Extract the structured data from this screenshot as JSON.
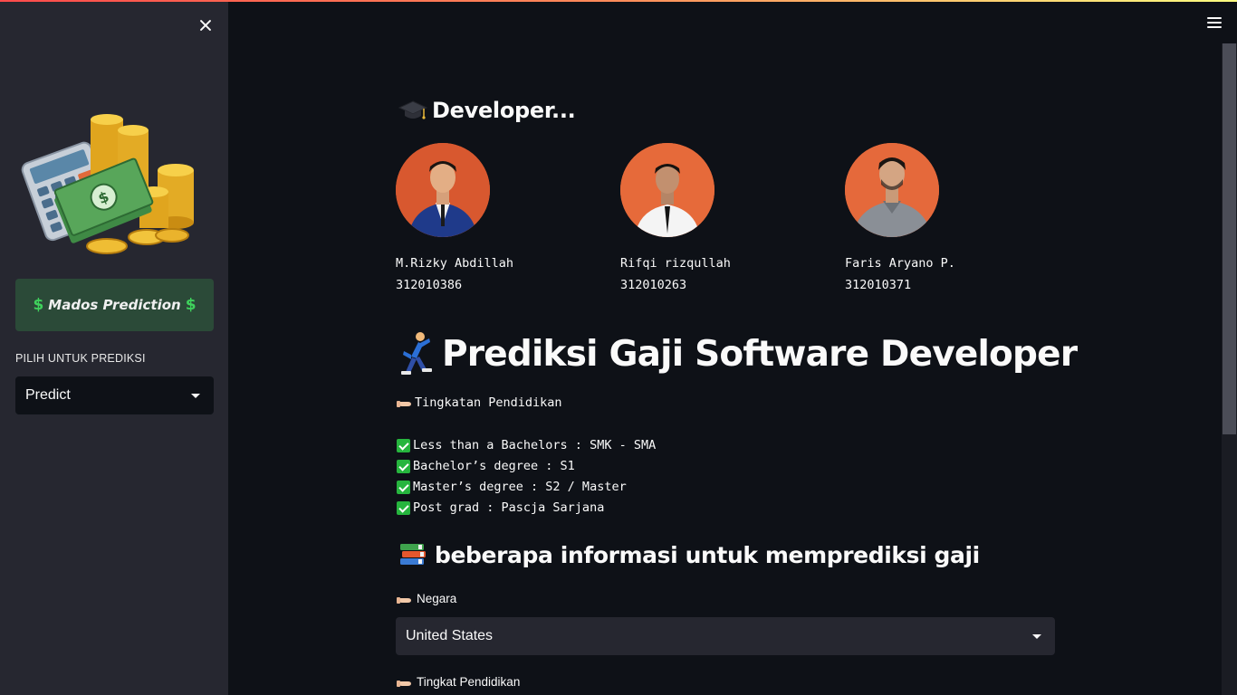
{
  "sidebar": {
    "banner_title": "Mados Prediction",
    "select_label": "PILIH UNTUK PREDIKSI",
    "select_value": "Predict"
  },
  "main": {
    "developers_heading": "Developer...",
    "developers": [
      {
        "name": "M.Rizky Abdillah",
        "id": "312010386"
      },
      {
        "name": "Rifqi rizqullah",
        "id": "312010263"
      },
      {
        "name": "Faris Aryano P.",
        "id": "312010371"
      }
    ],
    "title": "Prediksi Gaji Software Developer",
    "education_header": "Tingkatan Pendidikan",
    "education_items": [
      "Less than a Bachelors : SMK - SMA",
      "Bachelor’s degree : S1",
      "Master’s degree : S2 / Master",
      "Post grad : Pascja Sarjana"
    ],
    "info_heading": "beberapa informasi untuk memprediksi gaji",
    "country_label": "Negara",
    "country_value": "United States",
    "education_label": "Tingkat Pendidikan"
  },
  "colors": {
    "background": "#0e1117",
    "sidebar": "#262730",
    "banner": "#2b4a38",
    "check": "#26b53e",
    "avatar_bg": "#e5693b"
  }
}
